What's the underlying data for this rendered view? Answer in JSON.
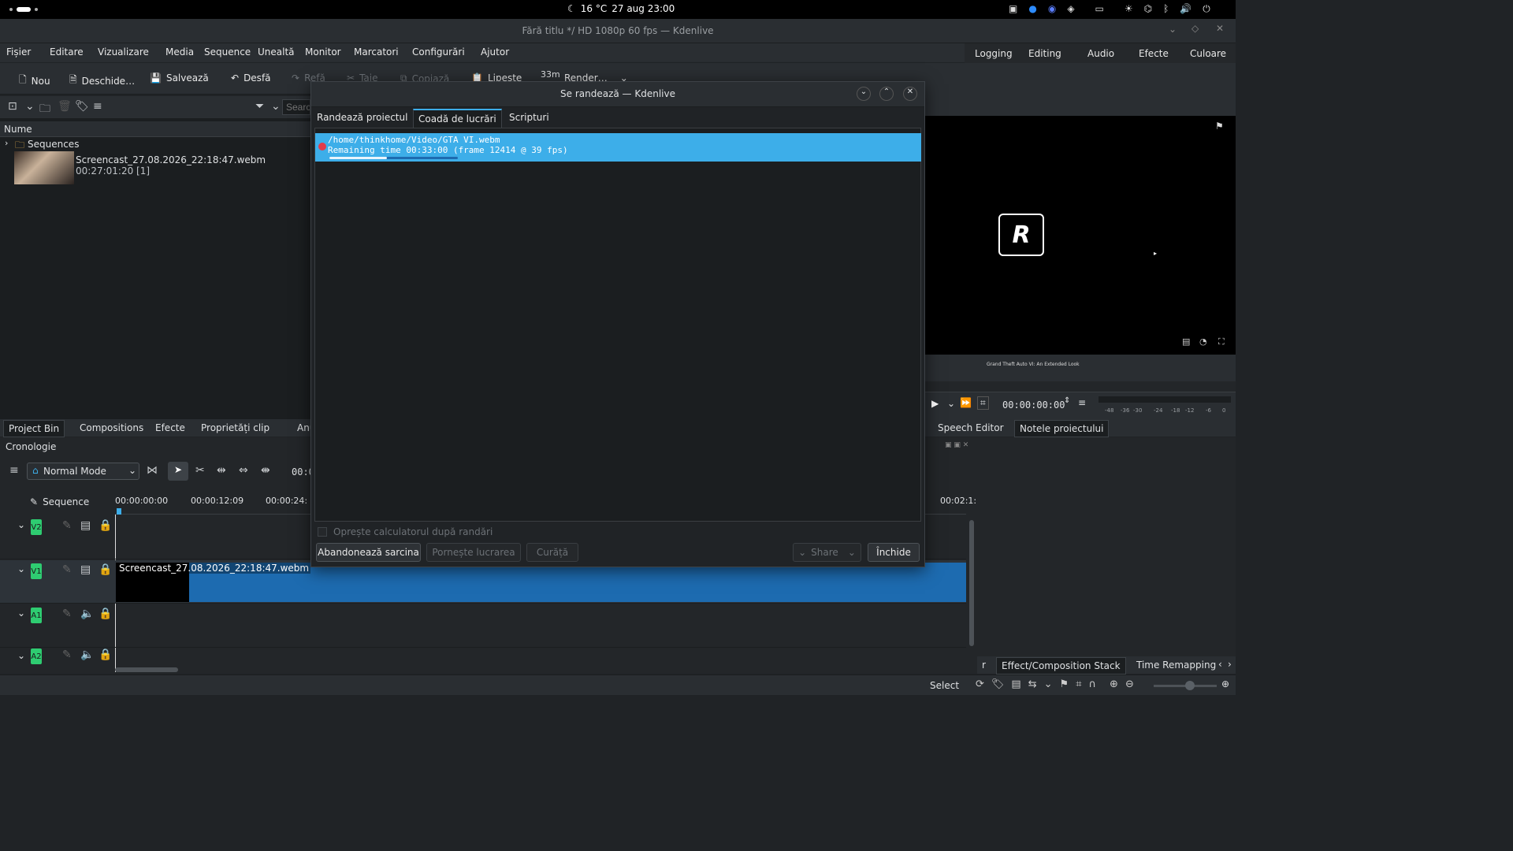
{
  "system_bar": {
    "weather": "16 °C",
    "datetime": "27 aug 23:00"
  },
  "window": {
    "title": "Fără titlu */ HD 1080p 60 fps — Kdenlive"
  },
  "menu": [
    "Fișier",
    "Editare",
    "Vizualizare",
    "Media",
    "Sequence",
    "Unealtă",
    "Monitor",
    "Marcatori",
    "Configurări",
    "Ajutor"
  ],
  "workspaces": [
    "Logging",
    "Editing",
    "Audio",
    "Efecte",
    "Culoare"
  ],
  "toolbar": {
    "new": "Nou",
    "open": "Deschide…",
    "save": "Salvează",
    "undo": "Desfă",
    "redo": "Refă",
    "cut": "Taie",
    "copy": "Copiază",
    "paste": "Lipește",
    "render_time": "33m",
    "render": "Render…"
  },
  "bin": {
    "search_placeholder": "Search",
    "column_name": "Nume",
    "folder": "Sequences",
    "clip_name": "Screencast_27.08.2026_22:18:47.webm",
    "clip_meta": "00:27:01:20 [1]"
  },
  "left_dock_tabs": [
    "Project Bin",
    "Compositions",
    "Efecte",
    "Proprietăți clip",
    "Anu"
  ],
  "right_dock_tabs": [
    "Speech Editor",
    "Notele proiectului"
  ],
  "monitor": {
    "caption": "Grand Theft Auto VI: An Extended Look",
    "timecode": "00:00:00:00",
    "db_scale": [
      "-48",
      "-36",
      "-30",
      "-24",
      "-18",
      "-12",
      "-6",
      "0"
    ]
  },
  "timeline": {
    "title": "Cronologie",
    "mode": "Normal Mode",
    "sequence_label": "Sequence",
    "timecode_short": "00:0",
    "ruler": [
      "00:00:00:00",
      "00:00:12:09",
      "00:00:24:",
      "00:02:1:"
    ],
    "tracks": [
      "V2",
      "V1",
      "A1",
      "A2"
    ],
    "clip_label": "Screencast_27.08.2026_22:18:47.webm"
  },
  "bottom_tabs": [
    "r",
    "Effect/Composition Stack",
    "Time Remapping"
  ],
  "status": {
    "tool": "Select"
  },
  "dialog": {
    "title": "Se randează — Kdenlive",
    "tabs": [
      "Randează proiectul",
      "Coadă de lucrări",
      "Scripturi"
    ],
    "active_tab": 1,
    "job": {
      "path": "/home/thinkhome/Video/GTA VI.webm",
      "status": "Remaining time 00:33:00 (frame 12414 @ 39 fps)",
      "progress": 0.45
    },
    "shutdown_label": "Oprește calculatorul după randări",
    "buttons": {
      "abort": "Abandonează sarcina",
      "start": "Pornește lucrarea",
      "clean": "Curăță",
      "share": "Share",
      "close": "Închide"
    }
  },
  "colors": {
    "accent": "#3daee9",
    "track_badge": "#2ecc71",
    "clip_blue": "#1d6bb0"
  }
}
